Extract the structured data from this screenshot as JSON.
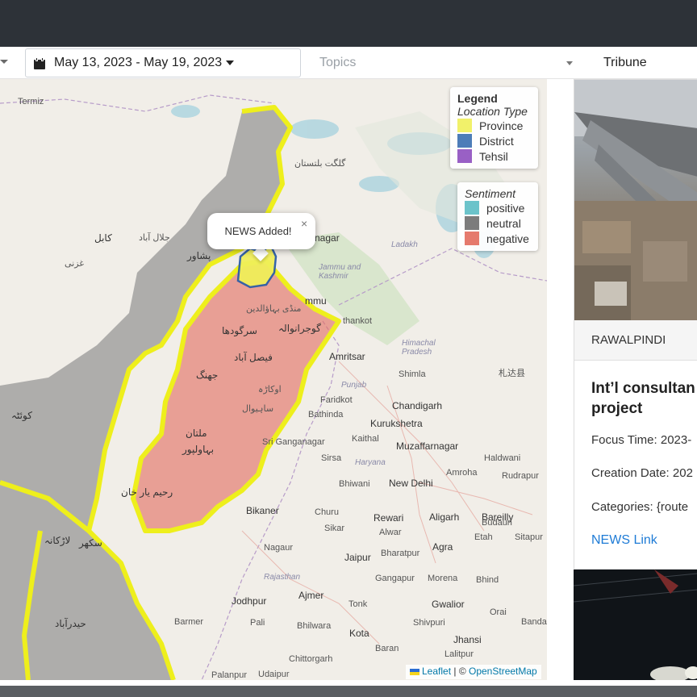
{
  "filters": {
    "date_range": "May 13, 2023 - May 19, 2023",
    "topics_placeholder": "Topics",
    "source": "Tribune"
  },
  "legend": {
    "title": "Legend",
    "location_type_heading": "Location Type",
    "location_types": [
      {
        "label": "Province",
        "color": "#f0ef5a"
      },
      {
        "label": "District",
        "color": "#3a6fb0"
      },
      {
        "label": "Tehsil",
        "color": "#8e4fbf"
      }
    ],
    "sentiment_heading": "Sentiment",
    "sentiments": [
      {
        "label": "positive",
        "color": "#5bbcc4"
      },
      {
        "label": "neutral",
        "color": "#6e6e6e"
      },
      {
        "label": "negative",
        "color": "#e26b5d"
      }
    ]
  },
  "popup": {
    "text": "NEWS Added!",
    "close": "×"
  },
  "map_labels": {
    "termiz": "Termiz",
    "kabul": "کابل",
    "jalalabad": "جلال آباد",
    "peshawar": "پشاور",
    "ghazni": "غزنی",
    "quetta": "کوئٹہ",
    "multan": "ملتان",
    "bahawalpur": "بہاولپور",
    "faisalabad": "فیصل آباد",
    "sargodha": "سرگودھا",
    "gujranwala": "گوجرانوالہ",
    "mandi": "منڈی بہاؤالدین",
    "jhang": "جھنگ",
    "sahiwal": "ساہیوال",
    "okara": "اوکاڑہ",
    "rahimyar": "رحیم یار خان",
    "sukkur": "سکھر",
    "larkana": "لاڑکانہ",
    "hyderabad": "حیدرآباد",
    "gilgit": "گلگت بلتستان",
    "srinagar": "nagar",
    "jammu": "mmu",
    "ladakh": "Ladakh",
    "jammu_kashmir": "Jammu and Kashmir",
    "pathankot": "thankot",
    "amritsar": "Amritsar",
    "himachal": "Himachal Pradesh",
    "shimla": "Shimla",
    "punjab": "Punjab",
    "chandigarh": "Chandigarh",
    "faridkot": "Faridkot",
    "bathinda": "Bathinda",
    "kurukshetra": "Kurukshetra",
    "kaithal": "Kaithal",
    "muzaffarnagar": "Muzaffarnagar",
    "ganganagar": "Sri Ganganagar",
    "sirsa": "Sirsa",
    "haryana": "Haryana",
    "haldwani": "Haldwani",
    "bhiwani": "Bhiwani",
    "new_delhi": "New Delhi",
    "amroha": "Amroha",
    "rudrapur": "Rudrapur",
    "bikaner": "Bikaner",
    "churu": "Churu",
    "rewari": "Rewari",
    "aligarh": "Aligarh",
    "bareilly": "Bareilly",
    "sikar": "Sikar",
    "alwar": "Alwar",
    "budaun": "Budaun",
    "etah": "Etah",
    "sitapur": "Sitapur",
    "nagaur": "Nagaur",
    "agra": "Agra",
    "jaipur": "Jaipur",
    "bharatpur": "Bharatpur",
    "rajasthan": "Rajasthan",
    "gangapur": "Gangapur",
    "morena": "Morena",
    "bhind": "Bhind",
    "ajmer": "Ajmer",
    "jodhpur": "Jodhpur",
    "tonk": "Tonk",
    "gwalior": "Gwalior",
    "barmer": "Barmer",
    "pali": "Pali",
    "bhilwara": "Bhilwara",
    "kota": "Kota",
    "shivpuri": "Shivpuri",
    "jhansi": "Jhansi",
    "baran": "Baran",
    "lalitpur": "Lalitpur",
    "chittorgarh": "Chittorgarh",
    "palanpur": "Palanpur",
    "udaipur": "Udaipur",
    "orai": "Orai",
    "banda": "Banda",
    "zhada": "札达县"
  },
  "attribution": {
    "leaflet": "Leaflet",
    "separator": " | © ",
    "osm": "OpenStreetMap"
  },
  "news_card": {
    "location": "RAWALPINDI",
    "title_line1": "Int’l consultan",
    "title_line2": "project",
    "focus_time": "Focus Time: 2023-",
    "creation_date": "Creation Date: 202",
    "categories": "Categories: {route",
    "link": "NEWS Link"
  }
}
